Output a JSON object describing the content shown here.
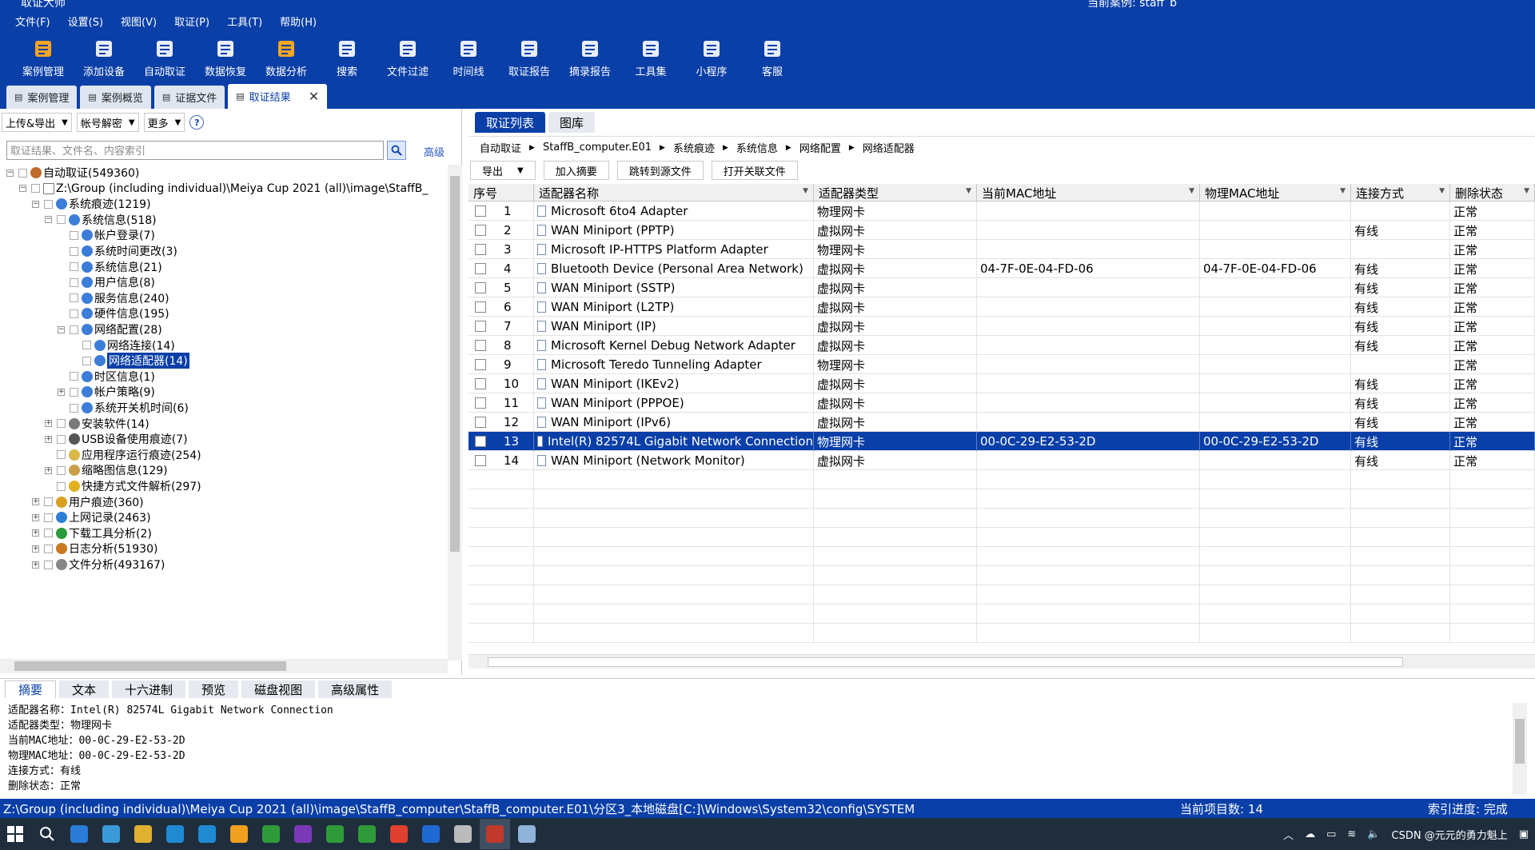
{
  "app": {
    "title": "取证大师",
    "current_case": "当前案例: staff_b"
  },
  "menu": [
    "文件(F)",
    "设置(S)",
    "视图(V)",
    "取证(P)",
    "工具(T)",
    "帮助(H)"
  ],
  "toolbar": [
    {
      "label": "案例管理",
      "icon": "case-icon",
      "color": "#f5a623"
    },
    {
      "label": "添加设备",
      "icon": "device-icon",
      "color": "#e8eef8"
    },
    {
      "label": "自动取证",
      "icon": "auto-icon",
      "color": "#e8eef8"
    },
    {
      "label": "数据恢复",
      "icon": "recover-icon",
      "color": "#e8eef8"
    },
    {
      "label": "数据分析",
      "icon": "analysis-icon",
      "color": "#f5a623"
    },
    {
      "label": "搜索",
      "icon": "search-icon",
      "color": "#e8eef8"
    },
    {
      "label": "文件过滤",
      "icon": "filter-icon",
      "color": "#e8eef8"
    },
    {
      "label": "时间线",
      "icon": "timeline-icon",
      "color": "#e8eef8"
    },
    {
      "label": "取证报告",
      "icon": "report-icon",
      "color": "#e8eef8"
    },
    {
      "label": "摘录报告",
      "icon": "excerpt-icon",
      "color": "#e8eef8"
    },
    {
      "label": "工具集",
      "icon": "tools-icon",
      "color": "#e8eef8"
    },
    {
      "label": "小程序",
      "icon": "miniapp-icon",
      "color": "#e8eef8"
    },
    {
      "label": "客服",
      "icon": "service-icon",
      "color": "#e8eef8"
    }
  ],
  "doc_tabs": [
    {
      "label": "案例管理",
      "active": false
    },
    {
      "label": "案例概览",
      "active": false
    },
    {
      "label": "证据文件",
      "active": false
    },
    {
      "label": "取证结果",
      "active": true
    }
  ],
  "left": {
    "dropdowns": [
      "上传&导出",
      "帐号解密",
      "更多"
    ],
    "search_placeholder": "取证结果、文件名、内容索引",
    "advanced": "高级",
    "tree": [
      {
        "label": "自动取证(549360)",
        "level": 0,
        "expand": "-",
        "icon": "#c06a2b"
      },
      {
        "label": "Z:\\Group (including individual)\\Meiya Cup 2021 (all)\\image\\StaffB_",
        "level": 1,
        "expand": "-",
        "icon": "#ffffff"
      },
      {
        "label": "系统痕迹(1219)",
        "level": 2,
        "expand": "-",
        "icon": "#3b7dd8"
      },
      {
        "label": "系统信息(518)",
        "level": 3,
        "expand": "-",
        "icon": "#3b7dd8"
      },
      {
        "label": "帐户登录(7)",
        "level": 4,
        "expand": "",
        "icon": "#3b7dd8"
      },
      {
        "label": "系统时间更改(3)",
        "level": 4,
        "expand": "",
        "icon": "#3b7dd8"
      },
      {
        "label": "系统信息(21)",
        "level": 4,
        "expand": "",
        "icon": "#3b7dd8"
      },
      {
        "label": "用户信息(8)",
        "level": 4,
        "expand": "",
        "icon": "#3b7dd8"
      },
      {
        "label": "服务信息(240)",
        "level": 4,
        "expand": "",
        "icon": "#3b7dd8"
      },
      {
        "label": "硬件信息(195)",
        "level": 4,
        "expand": "",
        "icon": "#3b7dd8"
      },
      {
        "label": "网络配置(28)",
        "level": 4,
        "expand": "-",
        "icon": "#3b7dd8"
      },
      {
        "label": "网络连接(14)",
        "level": 5,
        "expand": "",
        "icon": "#3b7dd8"
      },
      {
        "label": "网络适配器(14)",
        "level": 5,
        "expand": "",
        "icon": "#3b7dd8",
        "selected": true
      },
      {
        "label": "时区信息(1)",
        "level": 4,
        "expand": "",
        "icon": "#3b7dd8"
      },
      {
        "label": "帐户策略(9)",
        "level": 4,
        "expand": "+",
        "icon": "#3b7dd8"
      },
      {
        "label": "系统开关机时间(6)",
        "level": 4,
        "expand": "",
        "icon": "#3b7dd8"
      },
      {
        "label": "安装软件(14)",
        "level": 3,
        "expand": "+",
        "icon": "#7a7a7a"
      },
      {
        "label": "USB设备使用痕迹(7)",
        "level": 3,
        "expand": "+",
        "icon": "#555555"
      },
      {
        "label": "应用程序运行痕迹(254)",
        "level": 3,
        "expand": "",
        "icon": "#d9b84a"
      },
      {
        "label": "缩略图信息(129)",
        "level": 3,
        "expand": "+",
        "icon": "#c8a04a"
      },
      {
        "label": "快捷方式文件解析(297)",
        "level": 3,
        "expand": "",
        "icon": "#e0b020"
      },
      {
        "label": "用户痕迹(360)",
        "level": 2,
        "expand": "+",
        "icon": "#d8a020"
      },
      {
        "label": "上网记录(2463)",
        "level": 2,
        "expand": "+",
        "icon": "#2f7fd8"
      },
      {
        "label": "下载工具分析(2)",
        "level": 2,
        "expand": "+",
        "icon": "#2a9a3a"
      },
      {
        "label": "日志分析(51930)",
        "level": 2,
        "expand": "+",
        "icon": "#c87a20"
      },
      {
        "label": "文件分析(493167)",
        "level": 2,
        "expand": "+",
        "icon": "#888888"
      }
    ]
  },
  "right": {
    "tabs": [
      {
        "label": "取证列表",
        "active": true
      },
      {
        "label": "图库",
        "active": false
      }
    ],
    "breadcrumb": [
      "自动取证",
      "StaffB_computer.E01",
      "系统痕迹",
      "系统信息",
      "网络配置",
      "网络适配器"
    ],
    "actions": [
      "导出",
      "加入摘要",
      "跳转到源文件",
      "打开关联文件"
    ],
    "columns": [
      "序号",
      "适配器名称",
      "适配器类型",
      "当前MAC地址",
      "物理MAC地址",
      "连接方式",
      "删除状态"
    ],
    "rows": [
      {
        "n": "1",
        "name": "Microsoft 6to4 Adapter",
        "type": "物理网卡",
        "cur": "",
        "phy": "",
        "conn": "",
        "del": "正常"
      },
      {
        "n": "2",
        "name": "WAN Miniport (PPTP)",
        "type": "虚拟网卡",
        "cur": "",
        "phy": "",
        "conn": "有线",
        "del": "正常"
      },
      {
        "n": "3",
        "name": "Microsoft IP-HTTPS Platform Adapter",
        "type": "物理网卡",
        "cur": "",
        "phy": "",
        "conn": "",
        "del": "正常"
      },
      {
        "n": "4",
        "name": "Bluetooth Device (Personal Area Network)",
        "type": "虚拟网卡",
        "cur": "04-7F-0E-04-FD-06",
        "phy": "04-7F-0E-04-FD-06",
        "conn": "有线",
        "del": "正常"
      },
      {
        "n": "5",
        "name": "WAN Miniport (SSTP)",
        "type": "虚拟网卡",
        "cur": "",
        "phy": "",
        "conn": "有线",
        "del": "正常"
      },
      {
        "n": "6",
        "name": "WAN Miniport (L2TP)",
        "type": "虚拟网卡",
        "cur": "",
        "phy": "",
        "conn": "有线",
        "del": "正常"
      },
      {
        "n": "7",
        "name": "WAN Miniport (IP)",
        "type": "虚拟网卡",
        "cur": "",
        "phy": "",
        "conn": "有线",
        "del": "正常"
      },
      {
        "n": "8",
        "name": "Microsoft Kernel Debug Network Adapter",
        "type": "虚拟网卡",
        "cur": "",
        "phy": "",
        "conn": "有线",
        "del": "正常"
      },
      {
        "n": "9",
        "name": "Microsoft Teredo Tunneling Adapter",
        "type": "物理网卡",
        "cur": "",
        "phy": "",
        "conn": "",
        "del": "正常"
      },
      {
        "n": "10",
        "name": "WAN Miniport (IKEv2)",
        "type": "虚拟网卡",
        "cur": "",
        "phy": "",
        "conn": "有线",
        "del": "正常"
      },
      {
        "n": "11",
        "name": "WAN Miniport (PPPOE)",
        "type": "虚拟网卡",
        "cur": "",
        "phy": "",
        "conn": "有线",
        "del": "正常"
      },
      {
        "n": "12",
        "name": "WAN Miniport (IPv6)",
        "type": "虚拟网卡",
        "cur": "",
        "phy": "",
        "conn": "有线",
        "del": "正常"
      },
      {
        "n": "13",
        "name": "Intel(R) 82574L Gigabit Network Connection",
        "type": "物理网卡",
        "cur": "00-0C-29-E2-53-2D",
        "phy": "00-0C-29-E2-53-2D",
        "conn": "有线",
        "del": "正常",
        "selected": true
      },
      {
        "n": "14",
        "name": "WAN Miniport (Network Monitor)",
        "type": "虚拟网卡",
        "cur": "",
        "phy": "",
        "conn": "有线",
        "del": "正常"
      }
    ]
  },
  "bottom": {
    "tabs": [
      "摘要",
      "文本",
      "十六进制",
      "预览",
      "磁盘视图",
      "高级属性"
    ],
    "summary": [
      "适配器名称：Intel(R) 82574L Gigabit Network Connection",
      "适配器类型：物理网卡",
      "当前MAC地址：00-0C-29-E2-53-2D",
      "物理MAC地址：00-0C-29-E2-53-2D",
      "连接方式：有线",
      "删除状态：正常"
    ]
  },
  "status": {
    "path": "Z:\\Group (including individual)\\Meiya Cup 2021 (all)\\image\\StaffB_computer\\StaffB_computer.E01\\分区3_本地磁盘[C:]\\Windows\\System32\\config\\SYSTEM",
    "count": "当前项目数: 14",
    "progress": "索引进度: 完成"
  },
  "taskbar": {
    "apps": [
      "#2b7bd8",
      "#3a9ad8",
      "#e0b030",
      "#1f8ad2",
      "#1f8ad2",
      "#f0a020",
      "#2f9a3a",
      "#7a3ab8",
      "#2f9a3a",
      "#2f9a3a",
      "#e04030",
      "#1f6ad2",
      "#bbbbbb",
      "#c0392b",
      "#8fb3d9"
    ],
    "tray_text": "CSDN @元元的勇力魁上"
  }
}
